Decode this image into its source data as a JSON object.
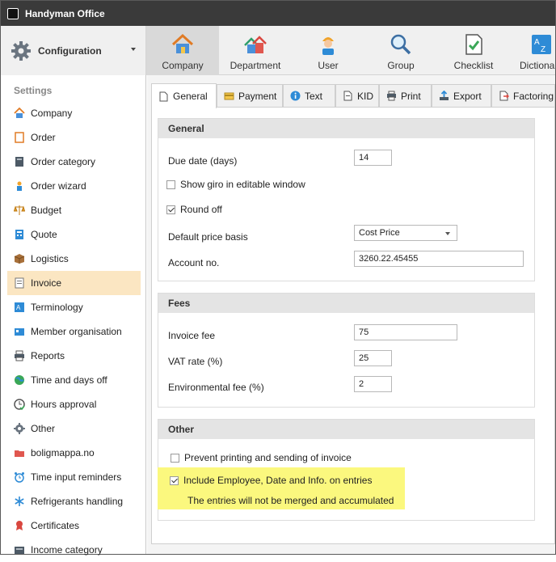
{
  "window": {
    "title": "Handyman Office"
  },
  "ribbon": {
    "config_label": "Configuration",
    "tabs": [
      {
        "label": "Company",
        "icon": "house-icon"
      },
      {
        "label": "Department",
        "icon": "houses-icon"
      },
      {
        "label": "User",
        "icon": "worker-icon"
      },
      {
        "label": "Group",
        "icon": "magnifier-icon"
      },
      {
        "label": "Checklist",
        "icon": "checklist-icon"
      },
      {
        "label": "Dictiona",
        "icon": "dictionary-icon"
      }
    ]
  },
  "sidebar": {
    "heading": "Settings",
    "items": [
      {
        "label": "Company",
        "icon": "house-icon"
      },
      {
        "label": "Order",
        "icon": "order-icon"
      },
      {
        "label": "Order category",
        "icon": "book-icon"
      },
      {
        "label": "Order wizard",
        "icon": "wizard-icon"
      },
      {
        "label": "Budget",
        "icon": "scales-icon"
      },
      {
        "label": "Quote",
        "icon": "calculator-icon"
      },
      {
        "label": "Logistics",
        "icon": "box-icon"
      },
      {
        "label": "Invoice",
        "icon": "invoice-icon"
      },
      {
        "label": "Terminology",
        "icon": "terminology-icon"
      },
      {
        "label": "Member organisation",
        "icon": "organisation-icon"
      },
      {
        "label": "Reports",
        "icon": "printer-icon"
      },
      {
        "label": "Time and days off",
        "icon": "globe-icon"
      },
      {
        "label": "Hours approval",
        "icon": "clock-check-icon"
      },
      {
        "label": "Other",
        "icon": "gear-icon"
      },
      {
        "label": "boligmappa.no",
        "icon": "boligmappa-icon"
      },
      {
        "label": "Time input reminders",
        "icon": "alarm-icon"
      },
      {
        "label": "Refrigerants handling",
        "icon": "snowflake-icon"
      },
      {
        "label": "Certificates",
        "icon": "certificate-icon"
      },
      {
        "label": "Income category",
        "icon": "income-icon"
      }
    ]
  },
  "subtabs": [
    {
      "label": "General"
    },
    {
      "label": "Payment"
    },
    {
      "label": "Text"
    },
    {
      "label": "KID"
    },
    {
      "label": "Print"
    },
    {
      "label": "Export"
    },
    {
      "label": "Factoring"
    }
  ],
  "general": {
    "heading": "General",
    "due_label": "Due date (days)",
    "due_value": "14",
    "giro_label": "Show giro in editable window",
    "round_label": "Round off",
    "price_label": "Default price basis",
    "price_value": "Cost Price",
    "account_label": "Account no.",
    "account_value": "3260.22.45455"
  },
  "fees": {
    "heading": "Fees",
    "invoice_fee_label": "Invoice fee",
    "invoice_fee_value": "75",
    "vat_label": "VAT rate (%)",
    "vat_value": "25",
    "env_label": "Environmental fee (%)",
    "env_value": "2"
  },
  "other": {
    "heading": "Other",
    "prevent_label": "Prevent printing and sending of invoice",
    "include_label": "Include Employee, Date and Info. on entries",
    "note": "The entries will not be merged and accumulated"
  },
  "colors": {
    "titlebar": "#3a3a3a",
    "active_sidebar": "#fbe6c2",
    "highlight": "#fbf87e",
    "accent": "#2e8bd6"
  }
}
